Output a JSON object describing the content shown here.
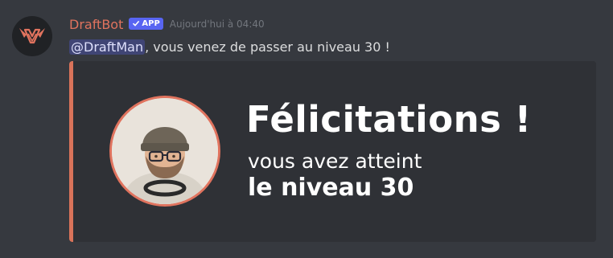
{
  "message": {
    "author": {
      "name": "DraftBot",
      "badge": "APP",
      "avatar_icon": "draftbot-logo-icon"
    },
    "timestamp": "Aujourd'hui à 04:40",
    "mention": "@DraftMan",
    "text": ", vous venez de passer au niveau 30 !"
  },
  "embed": {
    "accent_color": "#d9735a",
    "image": {
      "title": "Félicitations !",
      "line1": "vous avez atteint",
      "line2": "le niveau 30"
    }
  },
  "colors": {
    "background": "#36393f",
    "embed_background": "#2f3136",
    "username": "#e0735e",
    "badge": "#5865f2",
    "mention_bg": "#3f4487"
  }
}
